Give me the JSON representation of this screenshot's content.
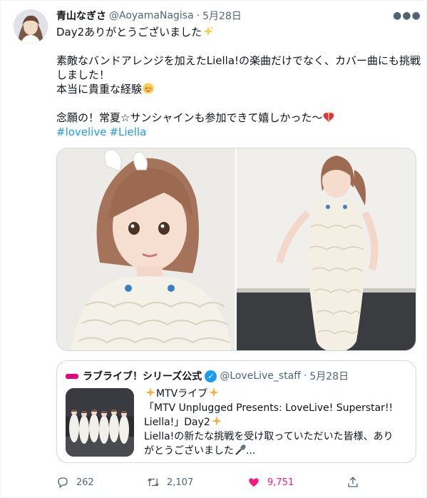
{
  "tweet": {
    "display_name": "青山なぎさ",
    "handle": "@AoyamaNagisa",
    "separator": "·",
    "date": "5月28日",
    "more_icon": "more-horizontal-icon",
    "lines": {
      "l1": "Day2ありがとうございました",
      "l2": "素敵なバンドアレンジを加えたLiella!の楽曲だけでなく、カバー曲にも挑戦",
      "l3": "しました！",
      "l4": "本当に貴重な経験",
      "l5": "念願の！常夏☆サンシャインも参加できて嬉しかった〜"
    },
    "hashtags": [
      "#lovelive",
      "#Liella"
    ],
    "emoji_icons": [
      "sparkles-icon",
      "relieved-face-icon",
      "heart-gift-icon"
    ]
  },
  "media": {
    "photos": [
      {
        "name": "photo-closeup",
        "alt": ""
      },
      {
        "name": "photo-fullbody",
        "alt": ""
      }
    ]
  },
  "quote": {
    "name": "ラブライブ！シリーズ公式",
    "handle": "@LoveLive_staff",
    "separator": "·",
    "date": "5月28日",
    "lines": {
      "l1": "MTVライブ",
      "l2": "「MTV Unplugged Presents: LoveLive! Superstar!!",
      "l3": "Liella!」Day2",
      "l4": "Liella!の新たな挑戦を受け取っていただいた皆様、あり",
      "l5": "がとうございました"
    },
    "ellipsis": "...",
    "emoji_icons": [
      "dizzy-icon",
      "dizzy-icon",
      "dizzy-icon",
      "microphone-icon"
    ]
  },
  "actions": {
    "reply_count": "262",
    "retweet_count": "2,107",
    "like_count": "9,751",
    "icons": [
      "reply-icon",
      "retweet-icon",
      "heart-icon",
      "share-icon"
    ],
    "like_color": "#f91880"
  },
  "colors": {
    "link": "#1d9bf0",
    "secondary_text": "#536471",
    "border": "#cfd9de"
  }
}
